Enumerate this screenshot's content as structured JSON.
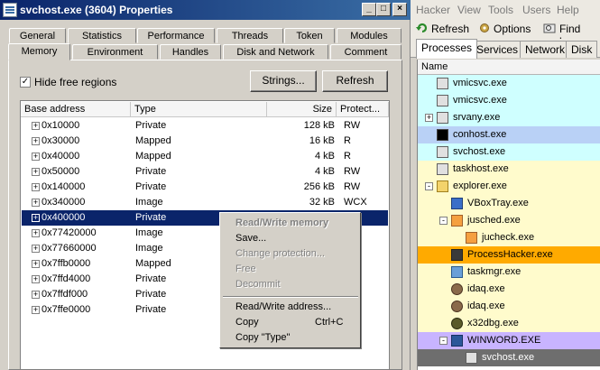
{
  "dialog": {
    "title": "svchost.exe (3604) Properties",
    "controls": {
      "minimize": "_",
      "maximize": "□",
      "close": "×"
    },
    "tabs_back": [
      "General",
      "Statistics",
      "Performance",
      "Threads",
      "Token",
      "Modules"
    ],
    "tabs_front": [
      "Memory",
      "Environment",
      "Handles",
      "Disk and Network",
      "Comment"
    ],
    "active_tab": "Memory",
    "hide_free_label": "Hide free regions",
    "hide_free_checked": true,
    "check_mark": "✓",
    "strings_button": "Strings...",
    "refresh_button": "Refresh",
    "columns": [
      "Base address",
      "Type",
      "Size",
      "Protect..."
    ],
    "rows": [
      {
        "exp": "+",
        "addr": "0x10000",
        "type": "Private",
        "size": "128 kB",
        "prot": "RW"
      },
      {
        "exp": "+",
        "addr": "0x30000",
        "type": "Mapped",
        "size": "16 kB",
        "prot": "R"
      },
      {
        "exp": "+",
        "addr": "0x40000",
        "type": "Mapped",
        "size": "4 kB",
        "prot": "R"
      },
      {
        "exp": "+",
        "addr": "0x50000",
        "type": "Private",
        "size": "4 kB",
        "prot": "RW"
      },
      {
        "exp": "+",
        "addr": "0x140000",
        "type": "Private",
        "size": "256 kB",
        "prot": "RW"
      },
      {
        "exp": "+",
        "addr": "0x340000",
        "type": "Image",
        "size": "32 kB",
        "prot": "WCX"
      },
      {
        "exp": "+",
        "addr": "0x400000",
        "type": "Private",
        "size": "",
        "prot": ""
      },
      {
        "exp": "+",
        "addr": "0x77420000",
        "type": "Image",
        "size": "",
        "prot": ""
      },
      {
        "exp": "+",
        "addr": "0x77660000",
        "type": "Image",
        "size": "",
        "prot": ""
      },
      {
        "exp": "+",
        "addr": "0x7ffb0000",
        "type": "Mapped",
        "size": "",
        "prot": ""
      },
      {
        "exp": "+",
        "addr": "0x7ffd4000",
        "type": "Private",
        "size": "",
        "prot": ""
      },
      {
        "exp": "+",
        "addr": "0x7ffdf000",
        "type": "Private",
        "size": "",
        "prot": ""
      },
      {
        "exp": "+",
        "addr": "0x7ffe0000",
        "type": "Private",
        "size": "",
        "prot": ""
      }
    ],
    "selected_row": "0x400000"
  },
  "context_menu": {
    "header": "Read/Write memory",
    "save": "Save...",
    "change_protection": "Change protection...",
    "free": "Free",
    "decommit": "Decommit",
    "rw_address": "Read/Write address...",
    "copy": "Copy",
    "copy_shortcut": "Ctrl+C",
    "copy_type": "Copy \"Type\""
  },
  "process_hacker": {
    "menus": [
      "Hacker",
      "View",
      "Tools",
      "Users",
      "Help"
    ],
    "toolbar": {
      "refresh": "Refresh",
      "options": "Options",
      "find": "Find han"
    },
    "tabs": [
      "Processes",
      "Services",
      "Network",
      "Disk"
    ],
    "active_tab": "Processes",
    "column": "Name",
    "processes": [
      {
        "name": "vmicsvc.exe",
        "color": "#cfffff",
        "icon": "service-window-icon"
      },
      {
        "name": "vmicsvc.exe",
        "color": "#cfffff",
        "icon": "service-window-icon"
      },
      {
        "name": "srvany.exe",
        "color": "#cfffff",
        "icon": "service-window-icon",
        "exp": "+"
      },
      {
        "name": "conhost.exe",
        "color": "#b9d1f6",
        "icon": "console-icon"
      },
      {
        "name": "svchost.exe",
        "color": "#cfffff",
        "icon": "service-window-icon"
      },
      {
        "name": "taskhost.exe",
        "color": "#fffbcc",
        "icon": "window-icon"
      },
      {
        "name": "explorer.exe",
        "color": "#fffbcc",
        "icon": "explorer-folder-icon",
        "exp": "-"
      },
      {
        "name": "VBoxTray.exe",
        "color": "#fffbcc",
        "icon": "vbox-icon"
      },
      {
        "name": "jusched.exe",
        "color": "#fffbcc",
        "icon": "java-icon",
        "exp": "-"
      },
      {
        "name": "jucheck.exe",
        "color": "#fffbcc",
        "icon": "java-icon"
      },
      {
        "name": "ProcessHacker.exe",
        "color": "#ffaa00",
        "icon": "process-hacker-icon"
      },
      {
        "name": "taskmgr.exe",
        "color": "#fffbcc",
        "icon": "task-manager-icon"
      },
      {
        "name": "idaq.exe",
        "color": "#fffbcc",
        "icon": "ida-icon"
      },
      {
        "name": "idaq.exe",
        "color": "#fffbcc",
        "icon": "ida-icon"
      },
      {
        "name": "x32dbg.exe",
        "color": "#fffbcc",
        "icon": "bug-icon"
      },
      {
        "name": "WINWORD.EXE",
        "color": "#c8b4ff",
        "icon": "word-icon",
        "exp": "-"
      },
      {
        "name": "svchost.exe",
        "color": "#6e6e6e",
        "icon": "service-window-icon",
        "text_color": "#ffffff"
      }
    ]
  },
  "colors": {
    "selection": "#0a246a",
    "title_start": "#0a246a",
    "title_end": "#3a6ea5"
  }
}
